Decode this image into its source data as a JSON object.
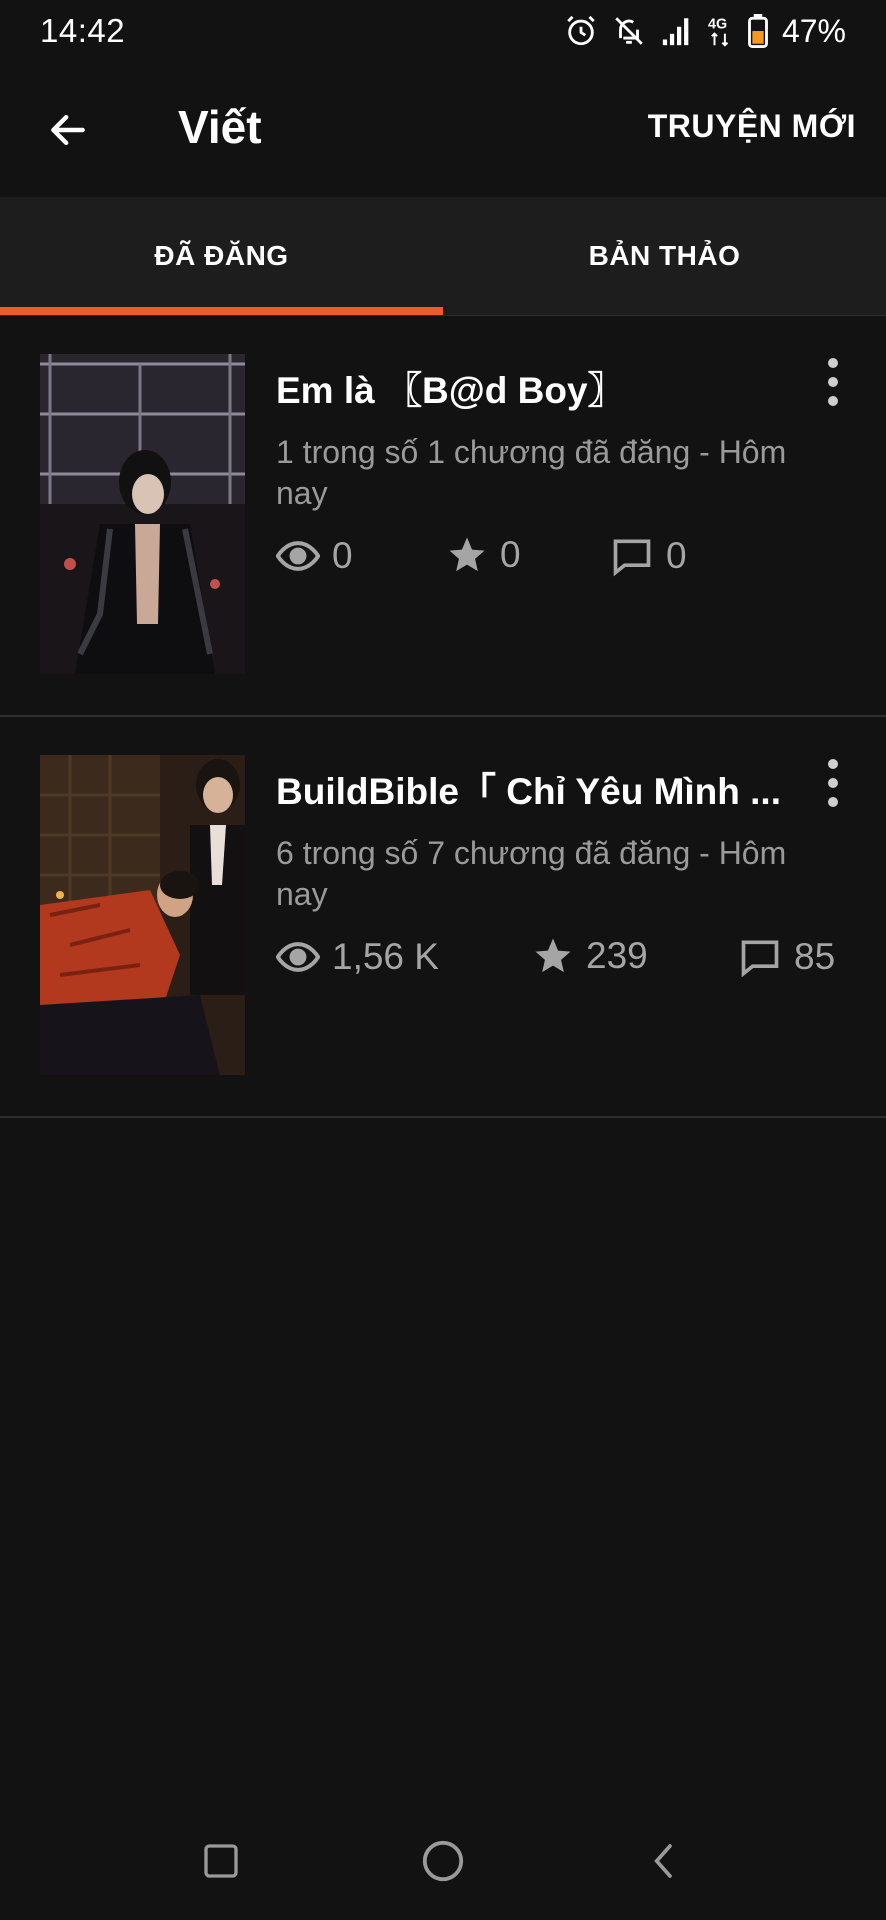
{
  "status_bar": {
    "time": "14:42",
    "network": "4G",
    "battery": "47%",
    "icons": [
      "alarm-icon",
      "bell-off-icon",
      "signal-icon",
      "network-4g-icon",
      "battery-icon"
    ]
  },
  "app_bar": {
    "title": "Viết",
    "new_story_label": "TRUYỆN MỚI",
    "back_icon": "arrow-left-icon"
  },
  "tabs": [
    {
      "label": "ĐÃ ĐĂNG",
      "selected": true
    },
    {
      "label": "BẢN THẢO",
      "selected": false
    }
  ],
  "accent_color": "#ee5a2a",
  "stories": [
    {
      "title": "Em là 〖B@d Boy〗",
      "meta": "1 trong số 1 chương đã đăng - Hôm nay",
      "views": "0",
      "votes": "0",
      "comments": "0"
    },
    {
      "title": "BuildBible「 Chỉ Yêu Mình ...",
      "meta": "6 trong số 7 chương đã đăng - Hôm nay",
      "views": "1,56 K",
      "votes": "239",
      "comments": "85"
    }
  ],
  "nav_bar": {
    "icons": [
      "recent-apps-icon",
      "home-icon",
      "back-nav-icon"
    ]
  }
}
